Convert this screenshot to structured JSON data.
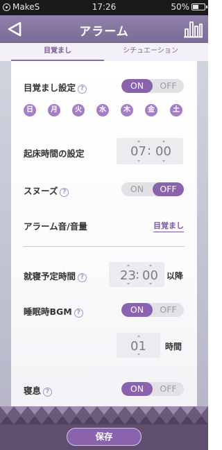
{
  "status_bar": {
    "app_name": "MakeS",
    "time": "17:26",
    "battery": "50%",
    "battery_level": 0.5
  },
  "header": {
    "title": "アラーム",
    "back_icon": "back-arrow-icon",
    "stats_icon": "bar-chart-icon"
  },
  "tabs": [
    {
      "label": "目覚まし",
      "active": true
    },
    {
      "label": "シチュエーション",
      "active": false
    }
  ],
  "alarm_setting": {
    "label": "目覚まし設定",
    "on": "ON",
    "off": "OFF",
    "selected": "ON"
  },
  "days": [
    "日",
    "月",
    "火",
    "水",
    "木",
    "金",
    "土"
  ],
  "wake_time": {
    "label": "起床時間の設定",
    "hour": "07",
    "minute": "00",
    "separator": ":"
  },
  "snooze": {
    "label": "スヌーズ",
    "on": "ON",
    "off": "OFF",
    "selected": "OFF"
  },
  "alarm_sound": {
    "label": "アラーム音/音量",
    "value": "目覚まし"
  },
  "bedtime": {
    "label": "就寝予定時間",
    "hour": "23",
    "minute": "00",
    "separator": ":",
    "suffix": "以降"
  },
  "sleep_bgm": {
    "label": "睡眠時BGM",
    "on": "ON",
    "off": "OFF",
    "selected": "ON",
    "duration": "01",
    "duration_unit": "時間"
  },
  "sleep_breath": {
    "label": "寝息",
    "on": "ON",
    "off": "OFF",
    "selected": "ON"
  },
  "footer": {
    "save_label": "保存"
  },
  "colors": {
    "accent": "#8a62ad",
    "header": "#8a7ba4",
    "footer": "#5f4f6e"
  }
}
